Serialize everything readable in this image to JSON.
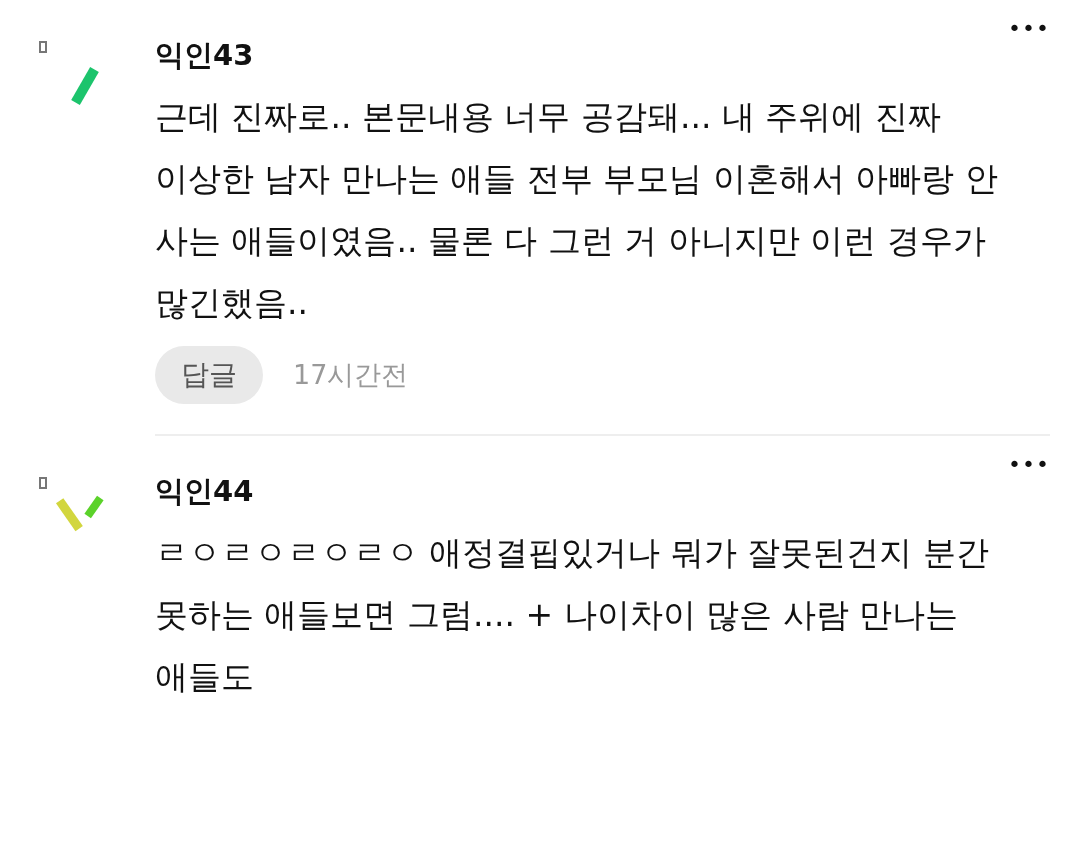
{
  "comments": [
    {
      "kind": "single-stroke",
      "author": "익인43",
      "more": "•••",
      "body": "근데 진짜로.. 본문내용 너무 공감돼... 내 주위에 진짜 이상한 남자 만나는 애들 전부 부모님 이혼해서 아빠랑 안 사는 애들이였음.. 물론 다 그런 거 아니지만 이런 경우가 많긴했음..",
      "reply": "답글",
      "time": "17시간전"
    },
    {
      "kind": "two-stroke",
      "author": "익인44",
      "more": "•••",
      "body": "ㄹㅇㄹㅇㄹㅇㄹㅇ 애정결핍있거나 뭐가 잘못된건지 분간 못하는 애들보면 그럼.... + 나이차이 많은 사람 만나는 애들도"
    }
  ]
}
